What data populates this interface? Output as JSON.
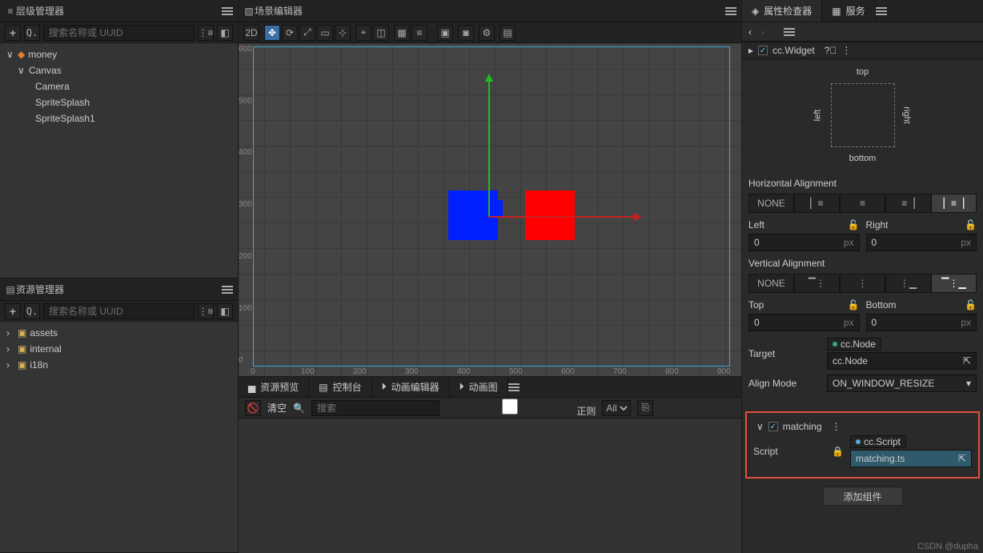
{
  "hierarchy": {
    "title": "层级管理器",
    "search_placeholder": "搜索名称或 UUID",
    "tree": [
      {
        "label": "money",
        "depth": 0,
        "arrow": "∨",
        "icon": "fire"
      },
      {
        "label": "Canvas",
        "depth": 1,
        "arrow": "∨"
      },
      {
        "label": "Camera",
        "depth": 2
      },
      {
        "label": "SpriteSplash",
        "depth": 2
      },
      {
        "label": "SpriteSplash1",
        "depth": 2
      }
    ]
  },
  "assets": {
    "title": "资源管理器",
    "search_placeholder": "搜索名称或 UUID",
    "tree": [
      {
        "label": "assets",
        "depth": 0,
        "arrow": ">",
        "color": "#d8b25a"
      },
      {
        "label": "internal",
        "depth": 0,
        "arrow": ">",
        "color": "#d8b25a"
      },
      {
        "label": "i18n",
        "depth": 0,
        "arrow": ">",
        "color": "#d8b25a"
      }
    ]
  },
  "scene": {
    "title": "场景编辑器",
    "mode2d": "2D",
    "ruler_y": [
      "600",
      "500",
      "400",
      "300",
      "200",
      "100",
      "0"
    ],
    "ruler_x": [
      "0",
      "100",
      "200",
      "300",
      "400",
      "500",
      "600",
      "700",
      "800",
      "900"
    ]
  },
  "bottom": {
    "tabs": [
      "资源预览",
      "控制台",
      "动画编辑器",
      "动画图"
    ],
    "active": 1,
    "clear": "清空",
    "search_placeholder": "搜索",
    "regex": "正则",
    "level": "All"
  },
  "inspector": {
    "tabs": [
      "属性检查器",
      "服务"
    ],
    "active": 0,
    "widget_comp": "cc.Widget",
    "align_labels": {
      "top": "top",
      "bottom": "bottom",
      "left": "left",
      "right": "right"
    },
    "h_align": {
      "title": "Horizontal Alignment",
      "none": "NONE",
      "left_label": "Left",
      "right_label": "Right",
      "left_val": "0",
      "right_val": "0",
      "unit": "px"
    },
    "v_align": {
      "title": "Vertical Alignment",
      "none": "NONE",
      "top_label": "Top",
      "bottom_label": "Bottom",
      "top_val": "0",
      "bottom_val": "0",
      "unit": "px"
    },
    "target": {
      "label": "Target",
      "type": "cc.Node",
      "value": "cc.Node"
    },
    "align_mode": {
      "label": "Align Mode",
      "value": "ON_WINDOW_RESIZE"
    },
    "matching": {
      "name": "matching",
      "script_label": "Script",
      "script_type": "cc.Script",
      "script_value": "matching.ts"
    },
    "add_component": "添加组件"
  },
  "watermark": "CSDN @dupha"
}
